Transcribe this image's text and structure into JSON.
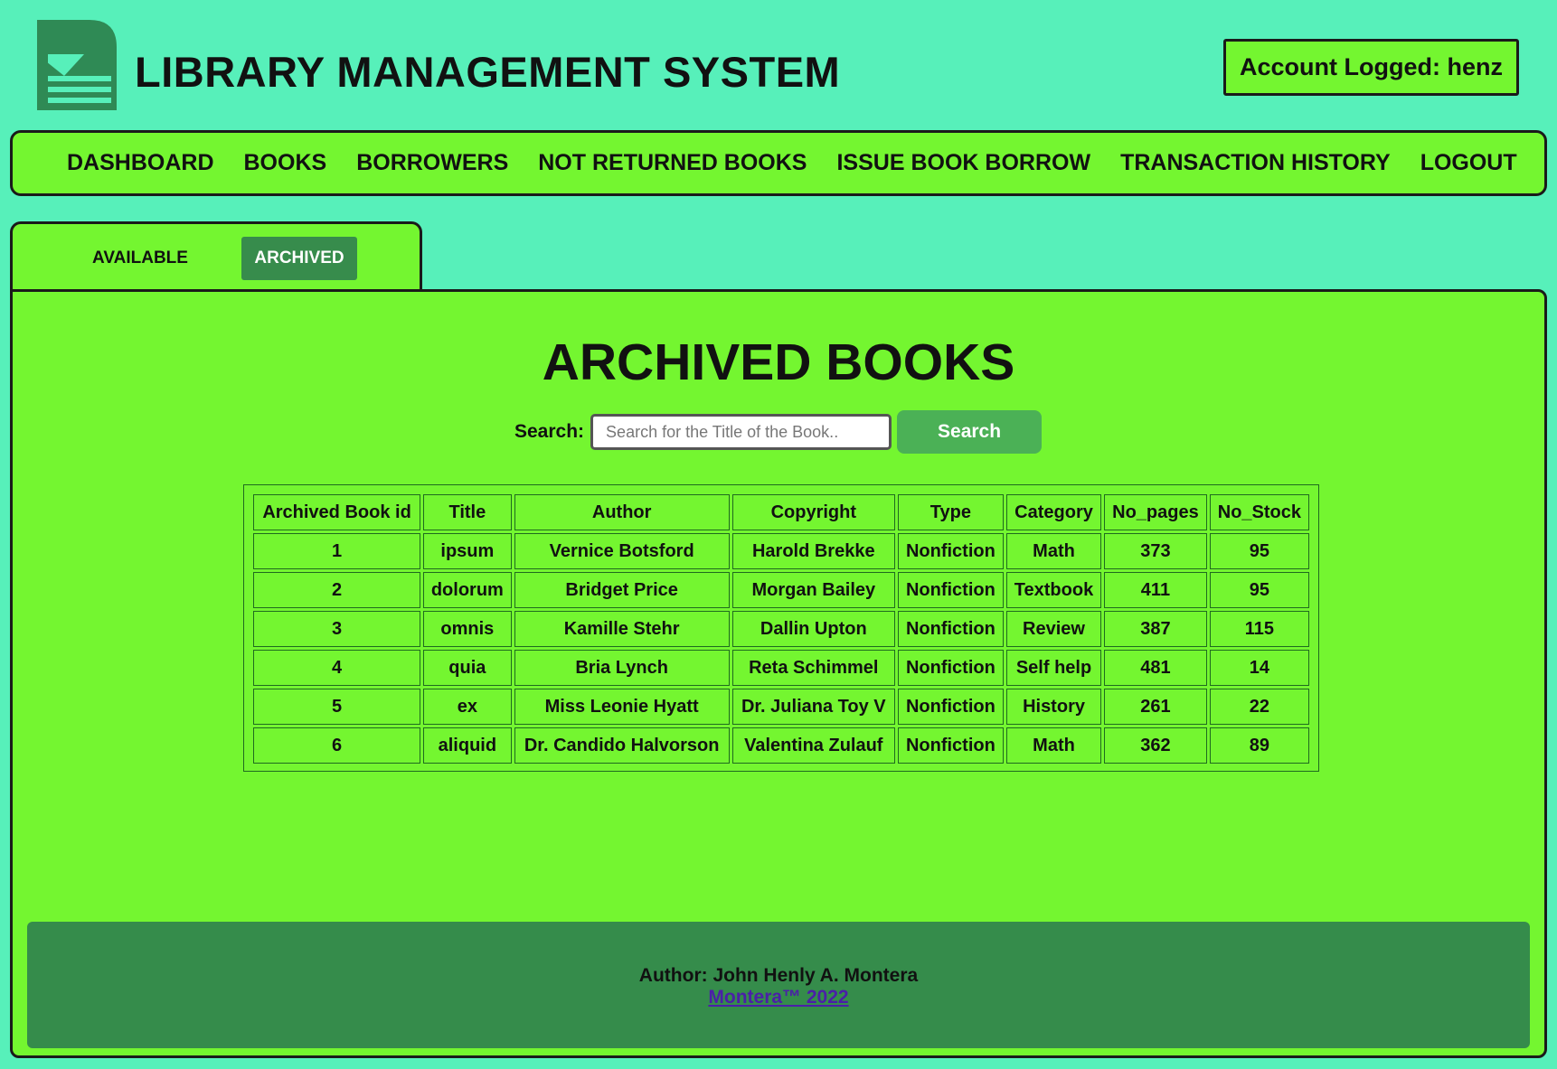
{
  "header": {
    "app_title": "LIBRARY MANAGEMENT SYSTEM",
    "account": "Account Logged: henz",
    "logo_icon": "book-stack-logo"
  },
  "nav": {
    "items": [
      "DASHBOARD",
      "BOOKS",
      "BORROWERS",
      "NOT RETURNED BOOKS",
      "ISSUE BOOK BORROW",
      "TRANSACTION HISTORY",
      "LOGOUT"
    ]
  },
  "tabs": {
    "available": "AVAILABLE",
    "archived": "ARCHIVED"
  },
  "main": {
    "heading": "ARCHIVED BOOKS",
    "search_label": "Search:",
    "search_placeholder": "Search for the Title of the Book..",
    "search_button": "Search"
  },
  "table": {
    "headers": [
      "Archived Book id",
      "Title",
      "Author",
      "Copyright",
      "Type",
      "Category",
      "No_pages",
      "No_Stock"
    ],
    "rows": [
      [
        "1",
        "ipsum",
        "Vernice Botsford",
        "Harold Brekke",
        "Nonfiction",
        "Math",
        "373",
        "95"
      ],
      [
        "2",
        "dolorum",
        "Bridget Price",
        "Morgan Bailey",
        "Nonfiction",
        "Textbook",
        "411",
        "95"
      ],
      [
        "3",
        "omnis",
        "Kamille Stehr",
        "Dallin Upton",
        "Nonfiction",
        "Review",
        "387",
        "115"
      ],
      [
        "4",
        "quia",
        "Bria Lynch",
        "Reta Schimmel",
        "Nonfiction",
        "Self help",
        "481",
        "14"
      ],
      [
        "5",
        "ex",
        "Miss Leonie Hyatt",
        "Dr. Juliana Toy V",
        "Nonfiction",
        "History",
        "261",
        "22"
      ],
      [
        "6",
        "aliquid",
        "Dr. Candido Halvorson",
        "Valentina Zulauf",
        "Nonfiction",
        "Math",
        "362",
        "89"
      ]
    ]
  },
  "footer": {
    "author": "Author: John Henly A. Montera",
    "link": "Montera™ 2022"
  },
  "colors": {
    "background": "#57f0ba",
    "panel": "#74f630",
    "accent_dark": "#378c4c",
    "footer": "#358c4b",
    "link": "#4b1fa8"
  }
}
